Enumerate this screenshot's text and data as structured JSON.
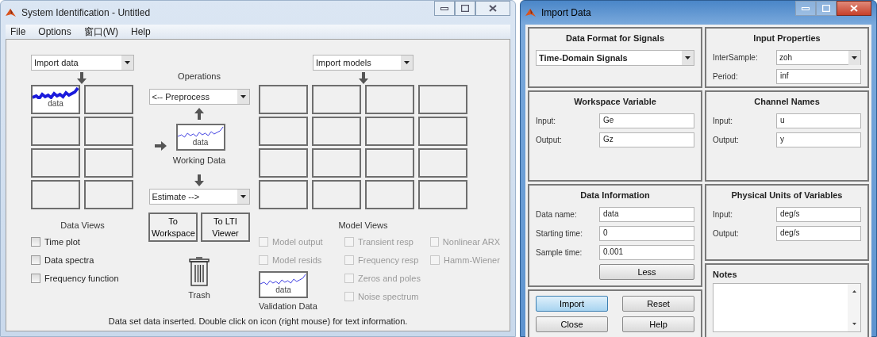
{
  "system_identification": {
    "title": "System Identification - Untitled",
    "active": false,
    "menu": [
      "File",
      "Options",
      "窗口(W)",
      "Help"
    ],
    "data_dropdown": "Import data",
    "data_boards": [
      {
        "kind": "signal",
        "label": "data"
      },
      {
        "kind": "empty"
      },
      {
        "kind": "empty"
      },
      {
        "kind": "empty"
      },
      {
        "kind": "empty"
      },
      {
        "kind": "empty"
      },
      {
        "kind": "empty"
      },
      {
        "kind": "empty"
      }
    ],
    "operations": {
      "title": "Operations",
      "preprocess": "<-- Preprocess",
      "working_data": {
        "label": "data",
        "caption": "Working Data"
      },
      "estimate": "Estimate -->"
    },
    "export_buttons": [
      "To Workspace",
      "To LTI Viewer"
    ],
    "trash_label": "Trash",
    "model_dropdown": "Import models",
    "model_boards": [
      {
        "kind": "empty"
      },
      {
        "kind": "empty"
      },
      {
        "kind": "empty"
      },
      {
        "kind": "empty"
      },
      {
        "kind": "empty"
      },
      {
        "kind": "empty"
      },
      {
        "kind": "empty"
      },
      {
        "kind": "empty"
      },
      {
        "kind": "empty"
      },
      {
        "kind": "empty"
      },
      {
        "kind": "empty"
      },
      {
        "kind": "empty"
      },
      {
        "kind": "empty"
      },
      {
        "kind": "empty"
      },
      {
        "kind": "empty"
      },
      {
        "kind": "empty"
      }
    ],
    "data_views": {
      "title": "Data Views",
      "checkboxes": [
        {
          "label": "Time plot",
          "checked": false,
          "disabled": false
        },
        {
          "label": "Data spectra",
          "checked": false,
          "disabled": false
        },
        {
          "label": "Frequency function",
          "checked": false,
          "disabled": false
        }
      ]
    },
    "model_views": {
      "title": "Model Views",
      "columns": [
        {
          "checkboxes": [
            {
              "label": "Model output",
              "checked": false,
              "disabled": true
            },
            {
              "label": "Model resids",
              "checked": false,
              "disabled": true
            }
          ]
        },
        {
          "checkboxes": [
            {
              "label": "Transient resp",
              "checked": false,
              "disabled": true
            },
            {
              "label": "Frequency resp",
              "checked": false,
              "disabled": true
            },
            {
              "label": "Zeros and poles",
              "checked": false,
              "disabled": true
            },
            {
              "label": "Noise spectrum",
              "checked": false,
              "disabled": true
            }
          ]
        },
        {
          "checkboxes": [
            {
              "label": "Nonlinear ARX",
              "checked": false,
              "disabled": true
            },
            {
              "label": "Hamm-Wiener",
              "checked": false,
              "disabled": true
            }
          ]
        }
      ]
    },
    "validation_data": {
      "label": "data",
      "caption": "Validation Data"
    },
    "status": "Data set data inserted.  Double click on icon (right mouse) for text information."
  },
  "import_data": {
    "title": "Import Data",
    "active": true,
    "data_format": {
      "title": "Data Format for Signals",
      "value": "Time-Domain Signals"
    },
    "input_properties": {
      "title": "Input Properties",
      "fields": [
        {
          "label": "InterSample:",
          "value": "zoh",
          "kind": "dropdown"
        },
        {
          "label": "Period:",
          "value": "inf",
          "kind": "text"
        }
      ]
    },
    "workspace_variable": {
      "title": "Workspace Variable",
      "fields": [
        {
          "label": "Input:",
          "value": "Ge",
          "kind": "text"
        },
        {
          "label": "Output:",
          "value": "Gz",
          "kind": "text"
        }
      ]
    },
    "channel_names": {
      "title": "Channel Names",
      "fields": [
        {
          "label": "Input:",
          "value": "u",
          "kind": "text"
        },
        {
          "label": "Output:",
          "value": "y",
          "kind": "text"
        }
      ]
    },
    "data_information": {
      "title": "Data Information",
      "fields": [
        {
          "label": "Data name:",
          "value": "data",
          "kind": "text"
        },
        {
          "label": "Starting time:",
          "value": "0",
          "kind": "text"
        },
        {
          "label": "Sample time:",
          "value": "0.001",
          "kind": "text"
        }
      ],
      "button": "Less"
    },
    "physical_units": {
      "title": "Physical Units of Variables",
      "fields": [
        {
          "label": "Input:",
          "value": "deg/s",
          "kind": "text"
        },
        {
          "label": "Output:",
          "value": "deg/s",
          "kind": "text"
        }
      ]
    },
    "notes": {
      "title": "Notes"
    },
    "buttons": [
      {
        "label": "Import",
        "focused": true
      },
      {
        "label": "Reset",
        "focused": false
      },
      {
        "label": "Close",
        "focused": false
      },
      {
        "label": "Help",
        "focused": false
      }
    ]
  }
}
